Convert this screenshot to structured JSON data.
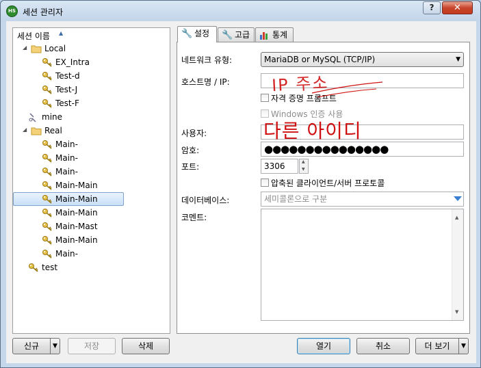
{
  "window": {
    "title": "세션 관리자",
    "app_icon_text": "HS",
    "help_label": "?",
    "close_label": "✕"
  },
  "tree": {
    "header_label": "세션 이름",
    "sort_arrow": "▲",
    "items": [
      {
        "label": "Local",
        "icon": "folder-icon",
        "expander": "◢",
        "level": 0
      },
      {
        "label": "EX_Intra",
        "icon": "key-icon",
        "level": 1
      },
      {
        "label": "Test-d",
        "icon": "key-icon",
        "level": 1
      },
      {
        "label": "Test-J",
        "icon": "key-icon",
        "level": 1
      },
      {
        "label": "Test-F",
        "icon": "key-icon",
        "level": 1
      },
      {
        "label": "mine",
        "icon": "link-icon",
        "level": 0
      },
      {
        "label": "Real",
        "icon": "folder-icon",
        "expander": "◢",
        "level": 0
      },
      {
        "label": "Main-",
        "icon": "key-icon",
        "level": 1
      },
      {
        "label": "Main-",
        "icon": "key-icon",
        "level": 1
      },
      {
        "label": "Main-",
        "icon": "key-icon",
        "level": 1
      },
      {
        "label": "Main-Main",
        "icon": "key-icon",
        "level": 1
      },
      {
        "label": "Main-Main",
        "icon": "key-icon",
        "level": 1,
        "selected": true
      },
      {
        "label": "Main-Main",
        "icon": "key-icon",
        "level": 1
      },
      {
        "label": "Main-Mast",
        "icon": "key-icon",
        "level": 1
      },
      {
        "label": "Main-Main",
        "icon": "key-icon",
        "level": 1
      },
      {
        "label": "Main-",
        "icon": "key-icon",
        "level": 1
      },
      {
        "label": "test",
        "icon": "key-icon",
        "level": 0
      }
    ]
  },
  "bottom_buttons": {
    "new": "신규",
    "new_split": "▼",
    "save": "저장",
    "delete": "삭제",
    "open": "열기",
    "cancel": "취소",
    "more": "더 보기",
    "more_split": "▼"
  },
  "tabs": [
    {
      "label": "설정",
      "icon": "wrench-icon",
      "active": true
    },
    {
      "label": "고급",
      "icon": "wrench-icon",
      "active": false
    },
    {
      "label": "통계",
      "icon": "bar-chart-icon",
      "active": false
    }
  ],
  "settings": {
    "network_type_label": "네트워크 유형:",
    "network_type_value": "MariaDB or MySQL (TCP/IP)",
    "network_type_arrow": "▼",
    "host_label": "호스트명 / IP:",
    "host_value": "",
    "credential_prompt_label": "자격 증명 프롬프트",
    "windows_auth_label": "Windows 인증 사용",
    "user_label": "사용자:",
    "user_value": "",
    "password_label": "암호:",
    "password_value": "●●●●●●●●●●●●●●●",
    "port_label": "포트:",
    "port_value": "3306",
    "compressed_label": "압축된 클라이언트/서버 프로토콜",
    "database_label": "데이터베이스:",
    "database_placeholder": "세미콜론으로 구분",
    "comment_label": "코멘트:",
    "comment_value": ""
  },
  "annotations": {
    "host_scribble": "IP 주소",
    "user_note": "다른 아이디"
  },
  "colors": {
    "annotation": "#d01010",
    "selection": "#c9e0f7"
  }
}
